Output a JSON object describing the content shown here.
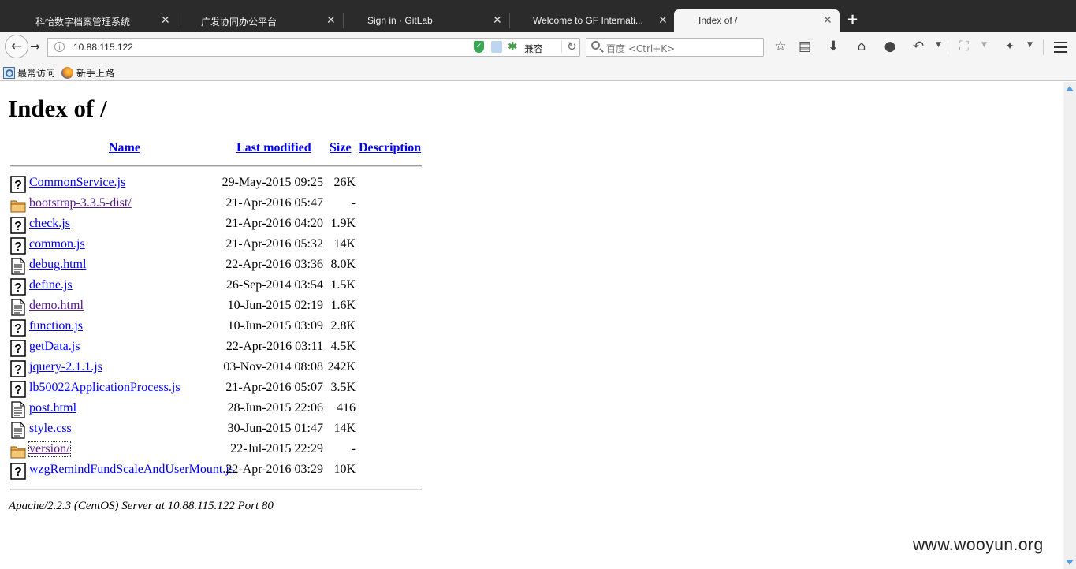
{
  "tabs": [
    {
      "title": "科怡数字档案管理系统",
      "close": "✕"
    },
    {
      "title": "广发协同办公平台",
      "close": "✕"
    },
    {
      "title": "Sign in · GitLab",
      "close": "✕"
    },
    {
      "title": "Welcome to GF Internati...",
      "close": "✕"
    },
    {
      "title": "Index of /",
      "close": "✕"
    }
  ],
  "new_tab_label": "+",
  "navbar": {
    "url": "10.88.115.122",
    "compat_label": "兼容",
    "search_placeholder": "百度 <Ctrl+K>"
  },
  "bookmarks": [
    {
      "label": "最常访问"
    },
    {
      "label": "新手上路"
    }
  ],
  "page": {
    "title": "Index of /",
    "columns": {
      "name": "Name",
      "last_modified": "Last modified",
      "size": "Size",
      "description": "Description"
    },
    "files": [
      {
        "icon": "unknown-file-icon",
        "name": "CommonService.js",
        "modified": "29-May-2015 09:25",
        "size": "26K"
      },
      {
        "icon": "folder-icon",
        "name": "bootstrap-3.3.5-dist/",
        "modified": "21-Apr-2016 05:47",
        "size": "-"
      },
      {
        "icon": "unknown-file-icon",
        "name": "check.js",
        "modified": "21-Apr-2016 04:20",
        "size": "1.9K"
      },
      {
        "icon": "unknown-file-icon",
        "name": "common.js",
        "modified": "21-Apr-2016 05:32",
        "size": "14K"
      },
      {
        "icon": "text-file-icon",
        "name": "debug.html",
        "modified": "22-Apr-2016 03:36",
        "size": "8.0K"
      },
      {
        "icon": "unknown-file-icon",
        "name": "define.js",
        "modified": "26-Sep-2014 03:54",
        "size": "1.5K"
      },
      {
        "icon": "text-file-icon",
        "name": "demo.html",
        "modified": "10-Jun-2015 02:19",
        "size": "1.6K"
      },
      {
        "icon": "unknown-file-icon",
        "name": "function.js",
        "modified": "10-Jun-2015 03:09",
        "size": "2.8K"
      },
      {
        "icon": "unknown-file-icon",
        "name": "getData.js",
        "modified": "22-Apr-2016 03:11",
        "size": "4.5K"
      },
      {
        "icon": "unknown-file-icon",
        "name": "jquery-2.1.1.js",
        "modified": "03-Nov-2014 08:08",
        "size": "242K"
      },
      {
        "icon": "unknown-file-icon",
        "name": "lb50022ApplicationProcess.js",
        "modified": "21-Apr-2016 05:07",
        "size": "3.5K"
      },
      {
        "icon": "text-file-icon",
        "name": "post.html",
        "modified": "28-Jun-2015 22:06",
        "size": "416"
      },
      {
        "icon": "text-file-icon",
        "name": "style.css",
        "modified": "30-Jun-2015 01:47",
        "size": "14K"
      },
      {
        "icon": "folder-icon",
        "name": "version/",
        "modified": "22-Jul-2015 22:29",
        "size": "-"
      },
      {
        "icon": "unknown-file-icon",
        "name": "wzgRemindFundScaleAndUserMount.js",
        "modified": "22-Apr-2016 03:29",
        "size": "10K"
      }
    ],
    "address": "Apache/2.2.3 (CentOS) Server at 10.88.115.122 Port 80"
  },
  "watermark": "www.wooyun.org"
}
